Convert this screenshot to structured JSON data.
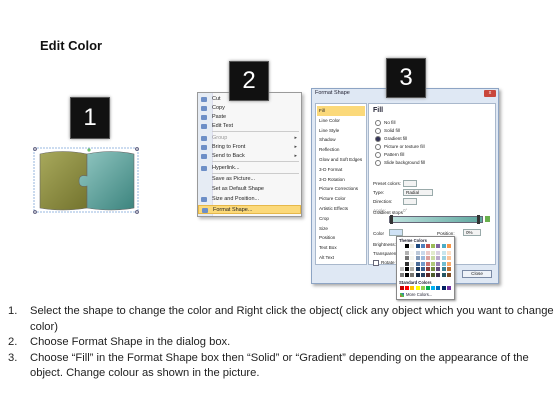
{
  "title": "Edit Color",
  "badges": [
    "1",
    "2",
    "3"
  ],
  "context_menu": {
    "items": [
      {
        "label": "Cut",
        "icon": "scissors-icon",
        "dim": false,
        "arrow": false,
        "hl": false
      },
      {
        "label": "Copy",
        "icon": "copy-icon",
        "dim": false,
        "arrow": false,
        "hl": false
      },
      {
        "label": "Paste",
        "icon": "paste-icon",
        "dim": false,
        "arrow": false,
        "hl": false
      },
      {
        "label": "Edit Text",
        "icon": "edit-text-icon",
        "dim": false,
        "arrow": false,
        "hl": false
      },
      {
        "label": "Group",
        "icon": "group-icon",
        "dim": true,
        "arrow": true,
        "hl": false
      },
      {
        "label": "Bring to Front",
        "icon": "bring-front-icon",
        "dim": false,
        "arrow": true,
        "hl": false
      },
      {
        "label": "Send to Back",
        "icon": "send-back-icon",
        "dim": false,
        "arrow": true,
        "hl": false
      },
      {
        "label": "Hyperlink...",
        "icon": "hyperlink-icon",
        "dim": false,
        "arrow": false,
        "hl": false
      },
      {
        "label": "Save as Picture...",
        "icon": "",
        "dim": false,
        "arrow": false,
        "hl": false
      },
      {
        "label": "Set as Default Shape",
        "icon": "",
        "dim": false,
        "arrow": false,
        "hl": false
      },
      {
        "label": "Size and Position...",
        "icon": "size-position-icon",
        "dim": false,
        "arrow": false,
        "hl": false
      },
      {
        "label": "Format Shape...",
        "icon": "format-shape-icon",
        "dim": false,
        "arrow": false,
        "hl": true
      }
    ]
  },
  "dialog": {
    "title": "Format Shape",
    "close_glyph": "x",
    "left_items": [
      "Fill",
      "Line Color",
      "Line Style",
      "Shadow",
      "Reflection",
      "Glow and Soft Edges",
      "3-D Format",
      "3-D Rotation",
      "Picture Corrections",
      "Picture Color",
      "Artistic Effects",
      "Crop",
      "Size",
      "Position",
      "Text Box",
      "Alt Text"
    ],
    "fill_heading": "Fill",
    "fill_options": [
      "No fill",
      "Solid fill",
      "Gradient fill",
      "Picture or texture fill",
      "Pattern fill",
      "Slide background fill"
    ],
    "selected_fill": "Gradient fill",
    "labels": {
      "preset": "Preset colors:",
      "type": "Type:",
      "type_value": "Radial",
      "direction": "Direction:",
      "angle": "Angle:",
      "angle_value": "0°",
      "gradient_stops": "Gradient stops",
      "color": "Color",
      "position": "Position:",
      "position_value": "0%",
      "brightness": "Brightness:",
      "transparency": "Transparency:",
      "rotate": "Rotate with shape",
      "close_button": "Close"
    },
    "palette": {
      "theme_heading": "Theme Colors",
      "standard_heading": "Standard Colors",
      "more": "More Colors..."
    }
  },
  "instructions": [
    {
      "n": "1.",
      "text": "Select the shape to change the color and Right click the object( click any object which you want to change color)"
    },
    {
      "n": "2.",
      "text": "Choose Format Shape in the dialog box."
    },
    {
      "n": "3.",
      "text": "Choose “Fill” in the Format Shape box then “Solid” or “Gradient” depending on the appearance of the object. Change colour as shown in the picture."
    }
  ],
  "colors": {
    "olive_piece": "#8b8a3a",
    "teal_piece": "#4f9b95",
    "highlight": "#fbd97a",
    "badge": "#111111"
  }
}
